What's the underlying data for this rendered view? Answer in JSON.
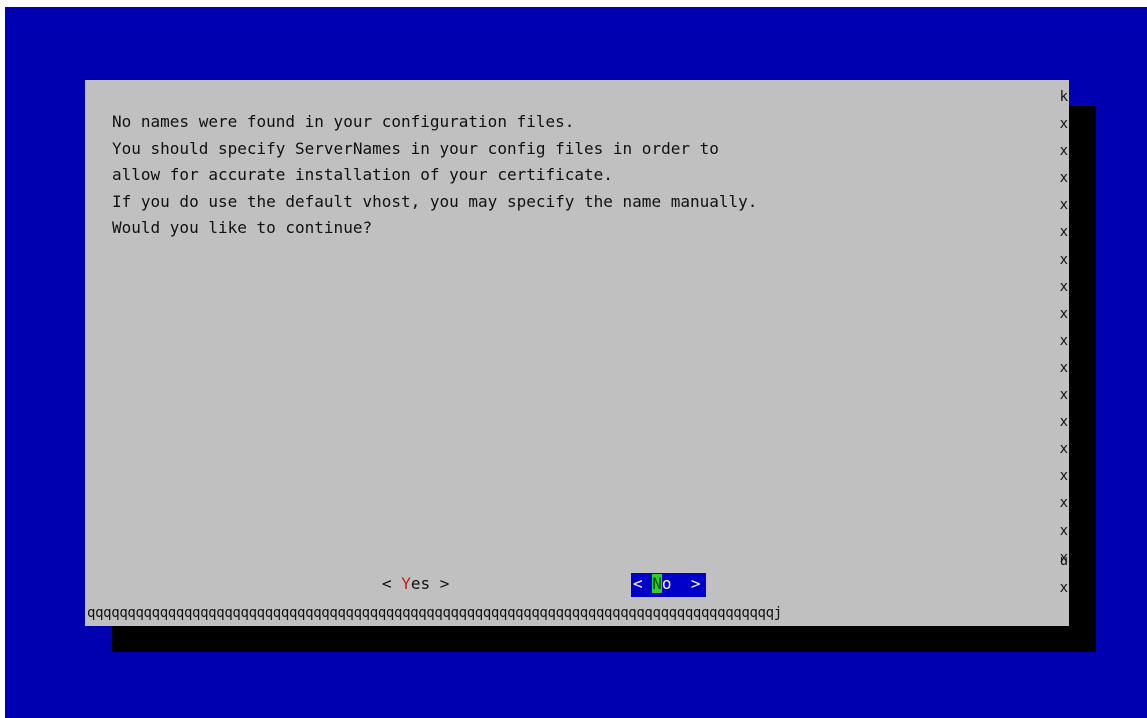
{
  "colors": {
    "screen_background": "#0000b0",
    "dialog_background": "#c0c0c0",
    "dialog_shadow": "#000000",
    "selected_button_background": "#0000c8",
    "selected_button_text": "#ffffff",
    "cursor_highlight": "#2ed02e",
    "hotkey_color": "#c02020"
  },
  "dialog": {
    "message_lines": [
      "No names were found in your configuration files.",
      "You should specify ServerNames in your config files in order to",
      "allow for accurate installation of your certificate.",
      "If you do use the default vhost, you may specify the name manually.",
      "Would you like to continue?"
    ],
    "border": {
      "top_right_corner": "k",
      "right_edge_char": "x",
      "tee_char": "u",
      "bottom_right_corner": "j",
      "bottom_edge": "qqqqqqqqqqqqqqqqqqqqqqqqqqqqqqqqqqqqqqqqqqqqqqqqqqqqqqqqqqqqqqqqqqqqqqqqqqqqqqqqqqqqqj"
    },
    "buttons": {
      "yes": {
        "open": "< ",
        "hotkey": "Y",
        "rest": "es",
        "close": " >"
      },
      "no": {
        "open": "< ",
        "hotkey": "N",
        "rest": "o",
        "close": "  >",
        "selected": true
      }
    }
  }
}
